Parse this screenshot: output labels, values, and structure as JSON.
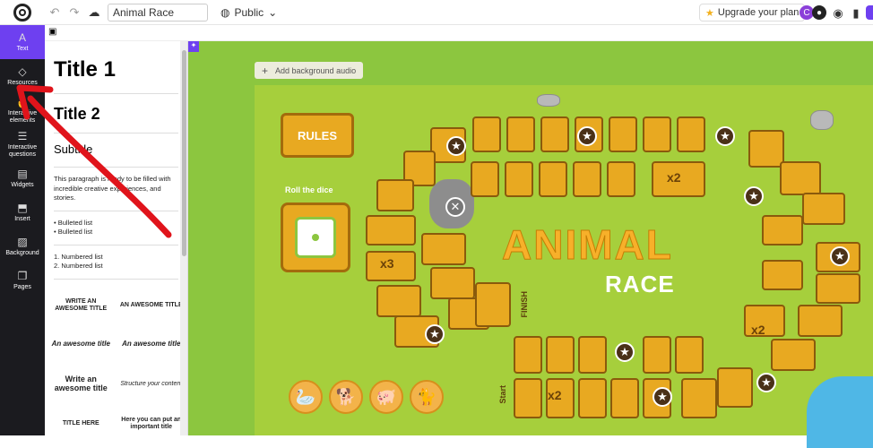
{
  "topbar": {
    "title_value": "Animal Race",
    "visibility": "Public",
    "upgrade_label": "Upgrade your plan",
    "avatar_letter": "C"
  },
  "leftnav": {
    "items": [
      {
        "label": "Text",
        "icon": "text-icon"
      },
      {
        "label": "Resources",
        "icon": "shapes-icon"
      },
      {
        "label": "Interactive elements",
        "icon": "touch-icon"
      },
      {
        "label": "Interactive questions",
        "icon": "checklist-icon"
      },
      {
        "label": "Widgets",
        "icon": "widgets-icon"
      },
      {
        "label": "Insert",
        "icon": "insert-icon"
      },
      {
        "label": "Background",
        "icon": "background-icon"
      },
      {
        "label": "Pages",
        "icon": "pages-icon"
      }
    ]
  },
  "panel": {
    "title1": "Title 1",
    "title2": "Title 2",
    "subtitle": "Subtitle",
    "paragraph": "This paragraph is ready to be filled with incredible creative experiences, and stories.",
    "bulleted": [
      "Bulleted list",
      "Bulleted list"
    ],
    "numbered": [
      "1. Numbered list",
      "2. Numbered list"
    ],
    "styles": [
      "WRITE AN AWESOME TITLE",
      "AN AWESOME TITLE",
      "An awesome title",
      "An awesome title",
      "Write an awesome title",
      "Structure your content",
      "TITLE HERE",
      "Here you can put an important title"
    ]
  },
  "canvas": {
    "bg_audio_label": "Add background audio",
    "rules_label": "RULES",
    "dice_label": "Roll the dice",
    "title_main": "ANIMAL",
    "title_sub": "RACE",
    "finish_label": "FINISH",
    "start_label": "Start",
    "multipliers": [
      "x2",
      "x3",
      "x2",
      "x2"
    ]
  }
}
